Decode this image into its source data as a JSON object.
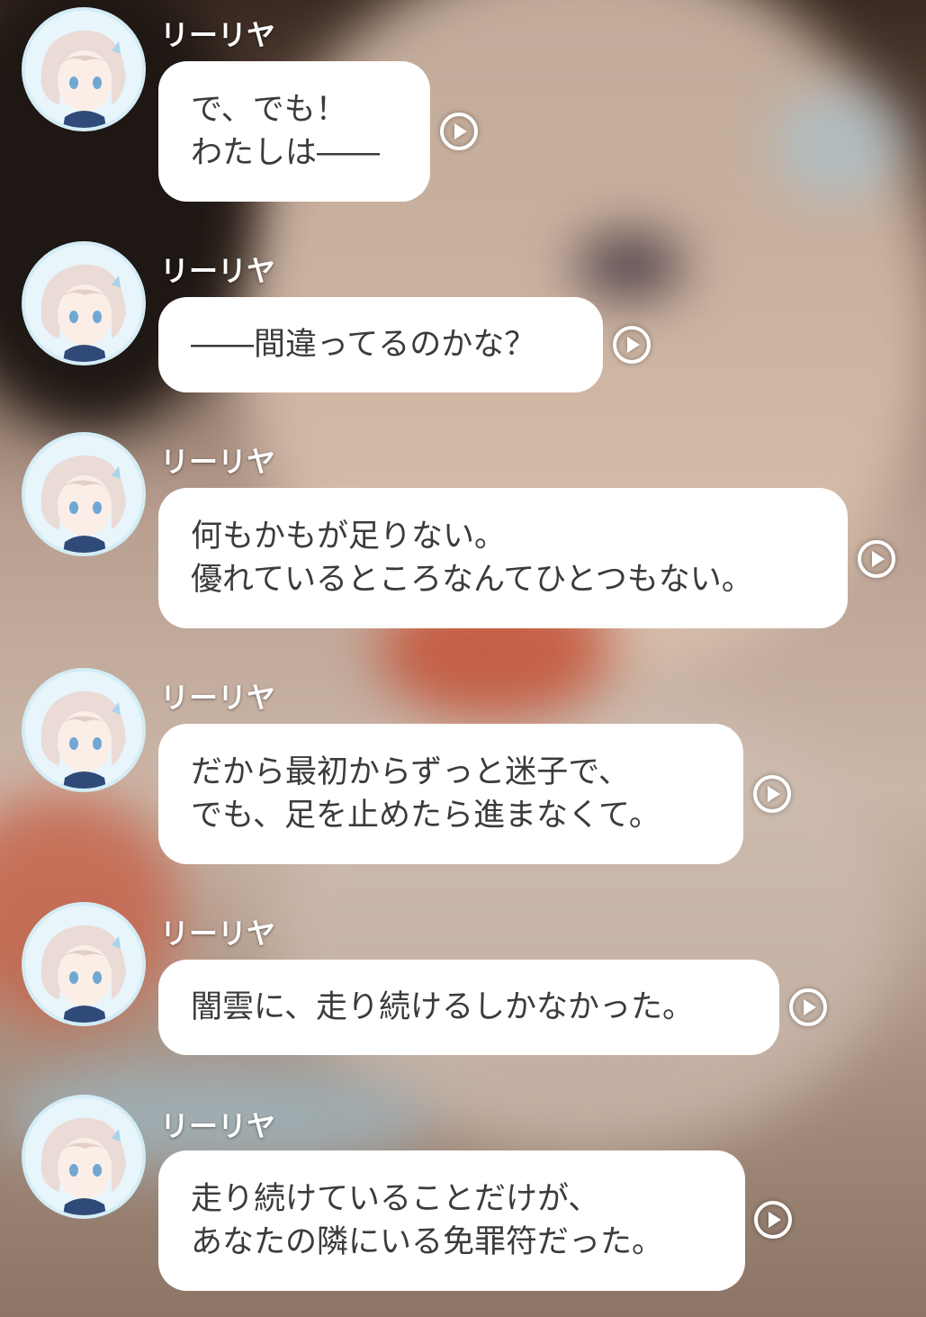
{
  "speaker": "リーリヤ",
  "messages": [
    {
      "lines": [
        "で、でも！",
        "わたしは――"
      ]
    },
    {
      "lines": [
        "――間違ってるのかな？"
      ]
    },
    {
      "lines": [
        "何もかもが足りない。",
        "優れているところなんてひとつもない。"
      ]
    },
    {
      "lines": [
        "だから最初からずっと迷子で、",
        "でも、足を止めたら進まなくて。"
      ]
    },
    {
      "lines": [
        "闇雲に、走り続けるしかなかった。"
      ]
    },
    {
      "lines": [
        "走り続けていることだけが、",
        "あなたの隣にいる免罪符だった。"
      ]
    }
  ],
  "icons": {
    "avatar": "character-portrait",
    "play": "play-voice-icon"
  },
  "colors": {
    "bubble": "#ffffff",
    "text": "#3b3b3b",
    "name": "#ffffff",
    "avatar_ring": "#d3ecf6"
  }
}
